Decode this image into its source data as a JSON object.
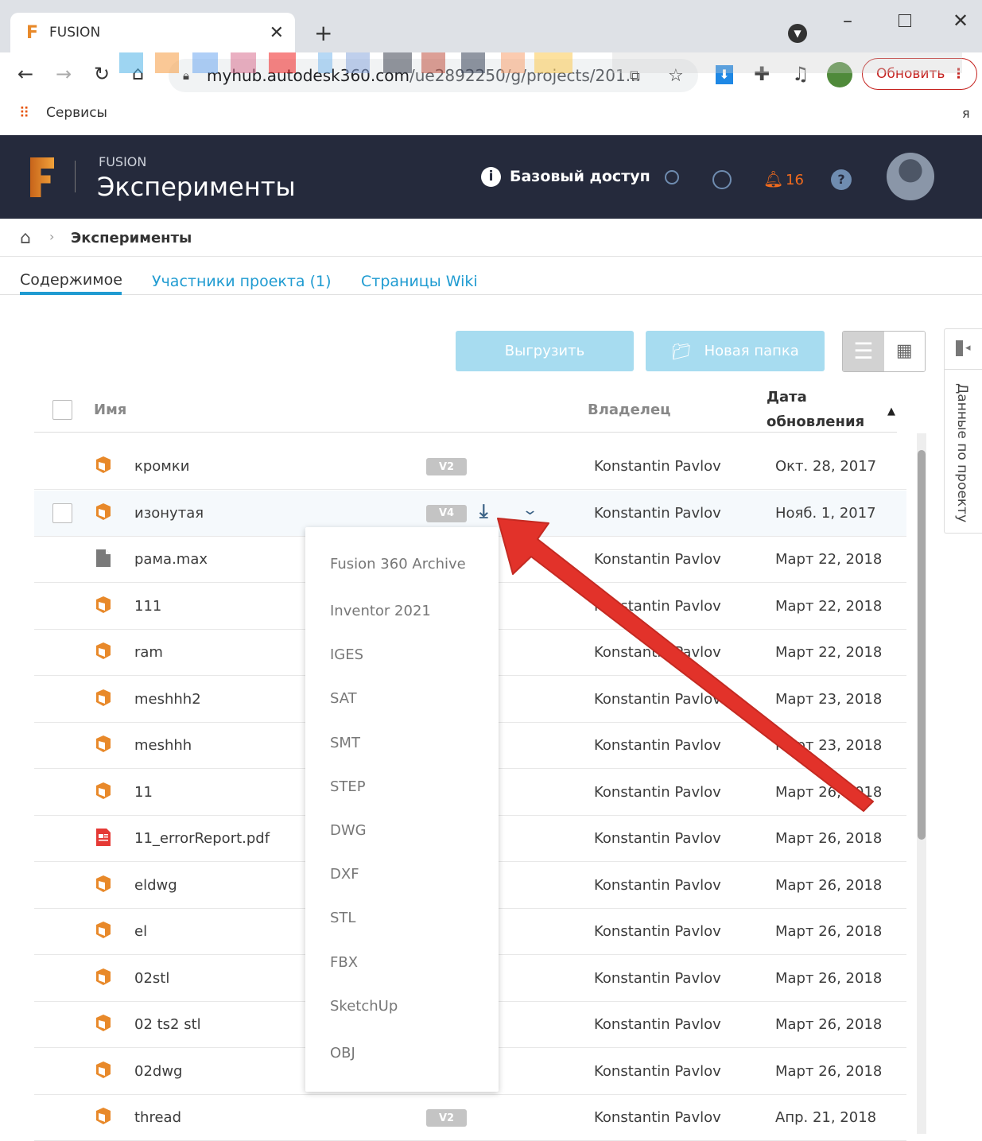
{
  "browser": {
    "tab_title": "FUSION",
    "url_host": "myhub.autodesk360.com",
    "url_path": "/ue2892250/g/projects/201...",
    "update_label": "Обновить",
    "bookmarks_apps": "Сервисы",
    "bookmark_tail": "я"
  },
  "header": {
    "product": "FUSION",
    "project": "Эксперименты",
    "access": "Базовый доступ",
    "notifications": "16"
  },
  "breadcrumb": {
    "current": "Эксперименты"
  },
  "tabs": [
    {
      "label": "Содержимое",
      "active": true
    },
    {
      "label": "Участники проекта (1)"
    },
    {
      "label": "Страницы Wiki"
    }
  ],
  "toolbar": {
    "upload": "Выгрузить",
    "new_folder": "Новая папка"
  },
  "table": {
    "col_name": "Имя",
    "col_owner": "Владелец",
    "col_date_1": "Дата",
    "col_date_2": "обновления",
    "sort": "ascending",
    "rows": [
      {
        "name": "кромки",
        "version": "V2",
        "owner": "Konstantin Pavlov",
        "date": "Окт. 28, 2017",
        "icon": "fusion-design-icon"
      },
      {
        "name": "изонутая",
        "version": "V4",
        "owner": "Konstantin Pavlov",
        "date": "Нояб. 1, 2017",
        "icon": "fusion-design-icon"
      },
      {
        "name": "рама.max",
        "owner": "Konstantin Pavlov",
        "date": "Март 22, 2018",
        "icon": "file-icon"
      },
      {
        "name": "111",
        "owner": "Konstantin Pavlov",
        "date": "Март 22, 2018",
        "icon": "fusion-design-icon"
      },
      {
        "name": "ram",
        "owner": "Konstantin Pavlov",
        "date": "Март 22, 2018",
        "icon": "fusion-design-icon"
      },
      {
        "name": "meshhh2",
        "owner": "Konstantin Pavlov",
        "date": "Март 23, 2018",
        "icon": "fusion-design-icon"
      },
      {
        "name": "meshhh",
        "owner": "Konstantin Pavlov",
        "date": "Март 23, 2018",
        "icon": "fusion-design-icon"
      },
      {
        "name": "11",
        "owner": "Konstantin Pavlov",
        "date": "Март 26, 2018",
        "icon": "fusion-design-icon"
      },
      {
        "name": "11_errorReport.pdf",
        "owner": "Konstantin Pavlov",
        "date": "Март 26, 2018",
        "icon": "pdf-icon"
      },
      {
        "name": "eldwg",
        "owner": "Konstantin Pavlov",
        "date": "Март 26, 2018",
        "icon": "fusion-design-icon"
      },
      {
        "name": "el",
        "owner": "Konstantin Pavlov",
        "date": "Март 26, 2018",
        "icon": "fusion-design-icon"
      },
      {
        "name": "02stl",
        "owner": "Konstantin Pavlov",
        "date": "Март 26, 2018",
        "icon": "fusion-design-icon"
      },
      {
        "name": "02 ts2 stl",
        "owner": "Konstantin Pavlov",
        "date": "Март 26, 2018",
        "icon": "fusion-design-icon"
      },
      {
        "name": "02dwg",
        "owner": "Konstantin Pavlov",
        "date": "Март 26, 2018",
        "icon": "fusion-design-icon"
      },
      {
        "name": "thread",
        "version": "V2",
        "owner": "Konstantin Pavlov",
        "date": "Апр. 21, 2018",
        "icon": "fusion-design-icon"
      }
    ]
  },
  "download_menu": [
    "Fusion 360 Archive",
    "Inventor 2021",
    "IGES",
    "SAT",
    "SMT",
    "STEP",
    "DWG",
    "DXF",
    "STL",
    "FBX",
    "SketchUp",
    "OBJ"
  ],
  "side_panel": {
    "label": "Данные по проекту"
  },
  "colors": {
    "header_bg": "#252a3c",
    "accent": "#1f9bd1",
    "fusion_orange": "#e8892a",
    "annotation_arrow": "#e2322a",
    "notification": "#f26b1d"
  }
}
